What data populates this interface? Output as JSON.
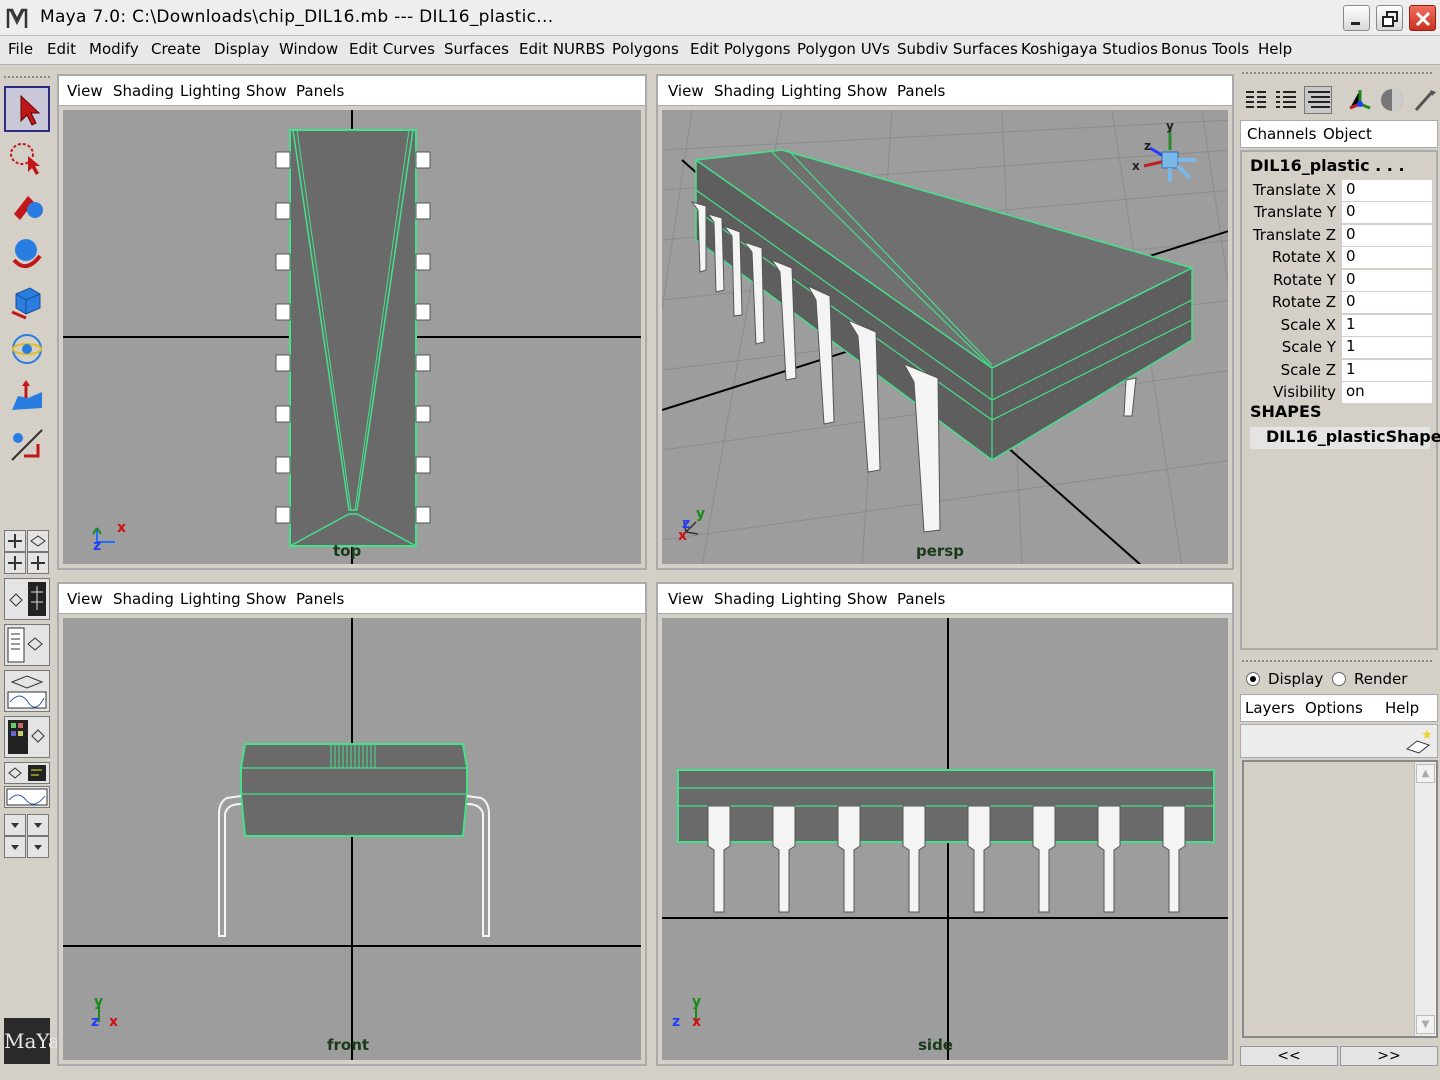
{
  "window": {
    "title": "Maya 7.0: C:\\Downloads\\chip_DIL16.mb   ---   DIL16_plastic..."
  },
  "menu": [
    "File",
    "Edit",
    "Modify",
    "Create",
    "Display",
    "Window",
    "Edit Curves",
    "Surfaces",
    "Edit NURBS",
    "Polygons",
    "Edit Polygons",
    "Polygon UVs",
    "Subdiv Surfaces",
    "Koshigaya Studios",
    "Bonus Tools",
    "Help"
  ],
  "viewport_menu": [
    "View",
    "Shading",
    "Lighting",
    "Show",
    "Panels"
  ],
  "viewports": {
    "top": {
      "label": "top"
    },
    "persp": {
      "label": "persp"
    },
    "front": {
      "label": "front"
    },
    "side": {
      "label": "side"
    }
  },
  "axes": {
    "x": "x",
    "y": "y",
    "z": "z"
  },
  "channel_box": {
    "tabs": [
      "Channels",
      "Object"
    ],
    "object_name": "DIL16_plastic . . .",
    "attributes": [
      {
        "name": "Translate X",
        "value": "0"
      },
      {
        "name": "Translate Y",
        "value": "0"
      },
      {
        "name": "Translate Z",
        "value": "0"
      },
      {
        "name": "Rotate X",
        "value": "0"
      },
      {
        "name": "Rotate Y",
        "value": "0"
      },
      {
        "name": "Rotate Z",
        "value": "0"
      },
      {
        "name": "Scale X",
        "value": "1"
      },
      {
        "name": "Scale Y",
        "value": "1"
      },
      {
        "name": "Scale Z",
        "value": "1"
      },
      {
        "name": "Visibility",
        "value": "on"
      }
    ],
    "shapes_header": "SHAPES",
    "shape_name": "DIL16_plasticShape"
  },
  "layer_editor": {
    "modes": [
      "Display",
      "Render"
    ],
    "selected_mode": "Display",
    "menu": [
      "Layers",
      "Options",
      "Help"
    ],
    "pager": [
      "<<",
      ">>"
    ]
  },
  "logo": "MaYa",
  "colors": {
    "viewport_bg": "#9d9d9d",
    "wire": "#44e08a",
    "body": "#6a6a6a"
  }
}
